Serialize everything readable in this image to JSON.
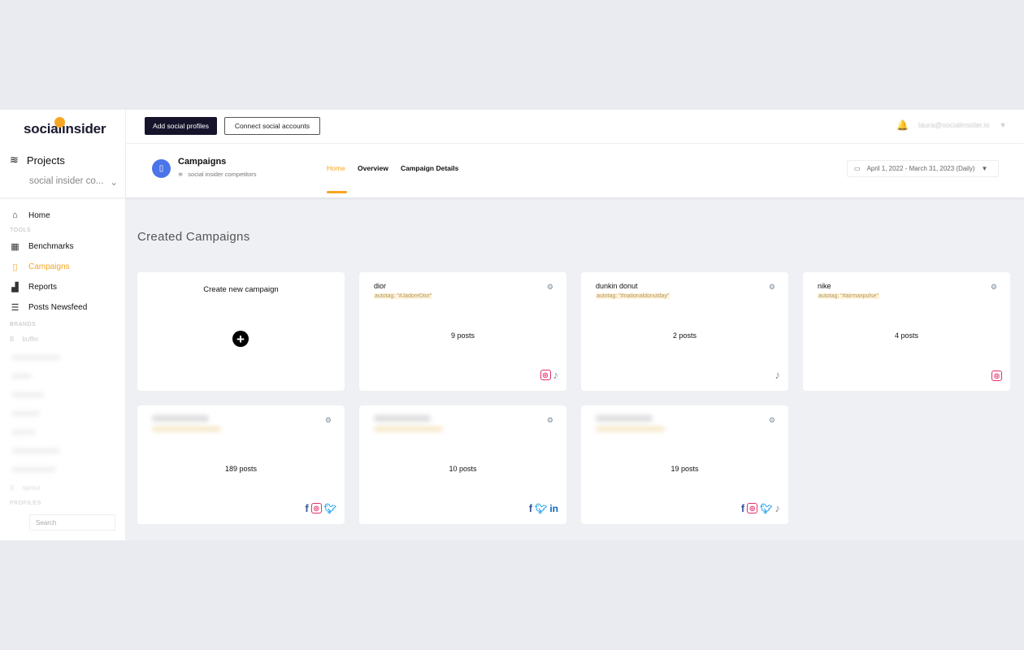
{
  "logo": "socialinsider",
  "sidebar": {
    "projects_label": "Projects",
    "project_selected": "social insider co...",
    "home": "Home",
    "tools_label": "TOOLS",
    "items": [
      {
        "label": "Benchmarks",
        "icon": "grid-icon"
      },
      {
        "label": "Campaigns",
        "icon": "bookmark-icon",
        "active": true
      },
      {
        "label": "Reports",
        "icon": "bar-chart-icon"
      },
      {
        "label": "Posts Newsfeed",
        "icon": "newsfeed-icon"
      }
    ],
    "brands_label": "BRANDS",
    "brands": [
      {
        "initial": "B",
        "name": "buffer"
      },
      {
        "initial": "S",
        "name": "sprout"
      }
    ],
    "profiles_label": "PROFILES",
    "search_placeholder": "Search"
  },
  "topbar": {
    "add_profiles": "Add social profiles",
    "connect_accounts": "Connect social accounts",
    "user_email": "laura@socialinsider.io"
  },
  "header": {
    "title": "Campaigns",
    "subtitle": "social insider competitors",
    "tabs": [
      "Home",
      "Overview",
      "Campaign Details"
    ],
    "active_tab": "Home",
    "date_range": "April 1, 2022 - March 31, 2023 (Daily)"
  },
  "colors": {
    "accent": "#f6a623",
    "primary_button": "#15142b",
    "badge": "#4a74e8"
  },
  "main": {
    "heading": "Created Campaigns",
    "create_label": "Create new campaign",
    "campaigns": [
      {
        "name": "dior",
        "autotag": "autotag: \"#JadoreDior\"",
        "posts": "9 posts",
        "networks": [
          "instagram",
          "tiktok"
        ]
      },
      {
        "name": "dunkin donut",
        "autotag": "autotag: \"#nationaldonutday\"",
        "posts": "2 posts",
        "networks": [
          "tiktok"
        ]
      },
      {
        "name": "nike",
        "autotag": "autotag: \"#airmaxpulse\"",
        "posts": "4 posts",
        "networks": [
          "instagram"
        ]
      },
      {
        "name": "",
        "autotag": "",
        "posts": "189 posts",
        "networks": [
          "facebook",
          "instagram",
          "twitter"
        ]
      },
      {
        "name": "",
        "autotag": "",
        "posts": "10 posts",
        "networks": [
          "facebook",
          "twitter",
          "linkedin"
        ]
      },
      {
        "name": "",
        "autotag": "",
        "posts": "19 posts",
        "networks": [
          "facebook",
          "instagram",
          "twitter",
          "tiktok"
        ]
      }
    ]
  }
}
